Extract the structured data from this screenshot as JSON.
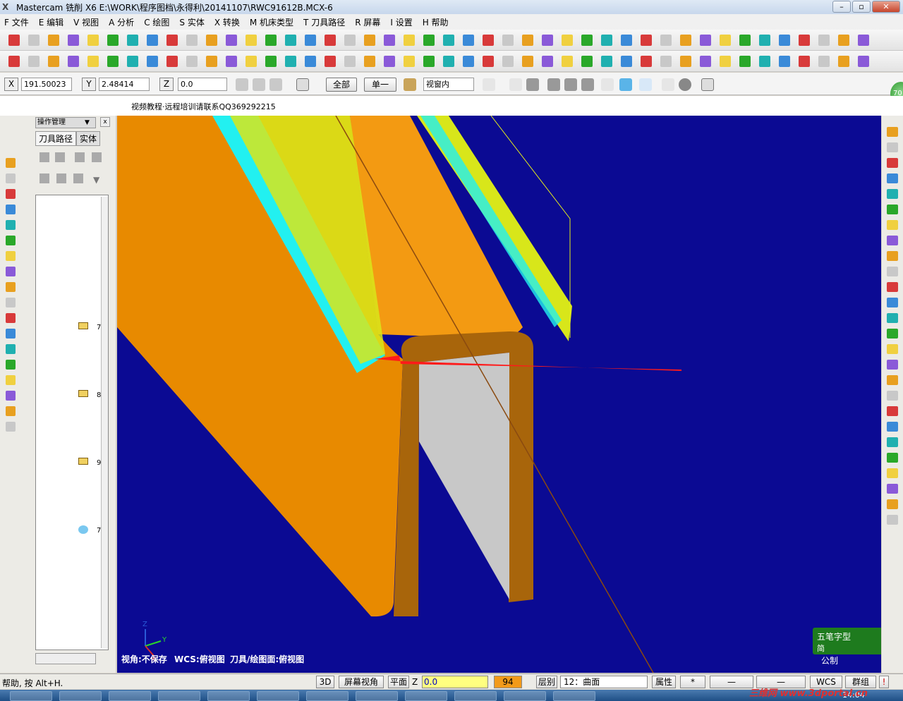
{
  "window": {
    "title": "Mastercam 铣削 X6  E:\\WORK\\程序图档\\永得利\\20141107\\RWC91612B.MCX-6"
  },
  "menu": {
    "items": [
      "F 文件",
      "E 编辑",
      "V 视图",
      "A 分析",
      "C 绘图",
      "S 实体",
      "X 转换",
      "M 机床类型",
      "T 刀具路径",
      "R 屏幕",
      "I 设置",
      "H 帮助"
    ]
  },
  "ribbon": {
    "x_label": "X",
    "x_value": "191.50023",
    "y_label": "Y",
    "y_value": "2.48414",
    "z_label": "Z",
    "z_value": "0.0",
    "all_button": "全部",
    "single_button": "单一",
    "view_select": "视窗内"
  },
  "banner": {
    "text": "视频教程·远程培训请联系QQ369292215"
  },
  "panel": {
    "header": "操作管理",
    "tabs": [
      "刀具路径",
      "实体"
    ],
    "tree_numbers": [
      "7",
      "8",
      "9",
      "7"
    ]
  },
  "viewport": {
    "view_status": "视角:不保存",
    "wcs_status": "WCS:俯视图",
    "plane_status": "刀具/绘图面:俯视图",
    "axis_y": "Y",
    "axis_z": "Z",
    "axis_x": "X"
  },
  "ime": {
    "mode": "五笔字型",
    "simple": "简"
  },
  "unit": "公制",
  "status": {
    "help_text": "帮助, 按 Alt+H.",
    "btn_3d": "3D",
    "btn_screen_view": "屏幕视角",
    "btn_plane": "平面",
    "z_label": "Z",
    "z_value": "0.0",
    "color_value": "94",
    "layer_label": "层别",
    "layer_value": "12：曲面",
    "attr_label": "属性",
    "wcs_label": "WCS",
    "group_label": "群组"
  },
  "taskbar": {
    "clock": "14:04"
  },
  "badge": {
    "value": "70"
  },
  "watermark": {
    "text": "三维网 www.3dportal.cn"
  },
  "colors": {
    "viewport_bg": "#0b0a93",
    "part_orange": "#e88a00",
    "part_dark": "#a8650b",
    "toolpath_yellow": "#e6ee1a",
    "toolpath_cyan": "#22f0f0",
    "arrow_red": "#ff1a1a"
  }
}
